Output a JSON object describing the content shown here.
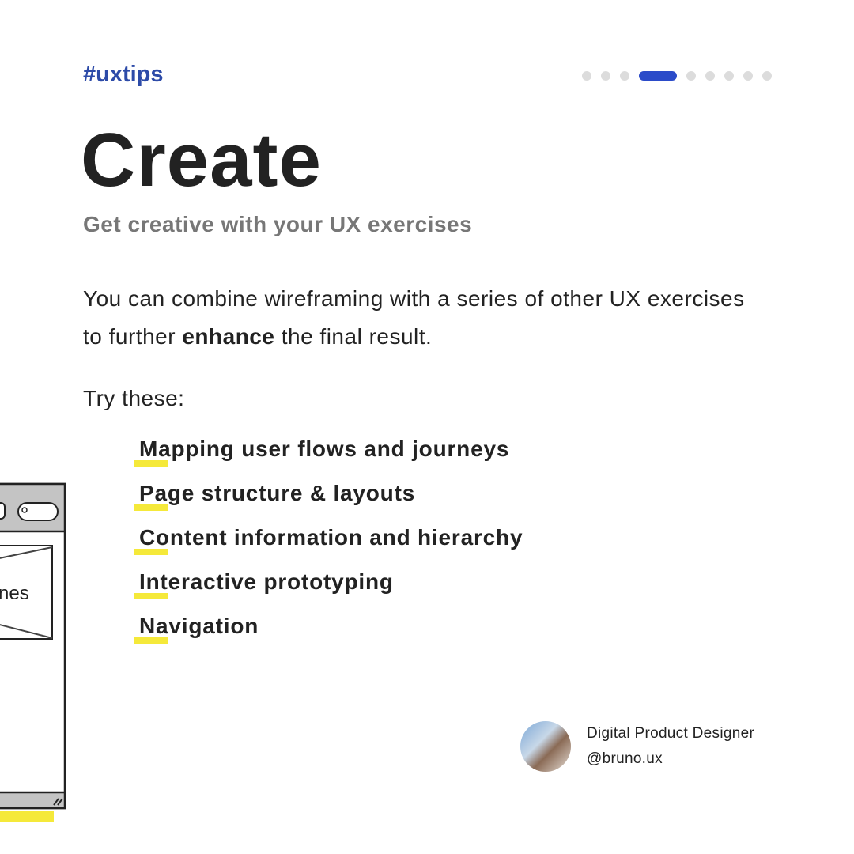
{
  "header": {
    "tag": "#uxtips",
    "pagination": {
      "total": 9,
      "active_index": 3,
      "active_color": "#2b4bc9"
    }
  },
  "title": "Create",
  "subtitle": "Get creative with your UX exercises",
  "body": {
    "line_before": "You can combine wireframing with a series of other UX exercises to further ",
    "bold": "enhance",
    "line_after": " the final result."
  },
  "try_label": "Try these:",
  "list": [
    {
      "label": "Mapping user flows and journeys"
    },
    {
      "label": "Page structure & layouts"
    },
    {
      "label": "Content information and hierarchy"
    },
    {
      "label": "Interactive prototyping"
    },
    {
      "label": "Navigation"
    }
  ],
  "illustration": {
    "text": "nes",
    "icon": "wireframe-browser-sketch"
  },
  "author": {
    "role": "Digital Product Designer",
    "handle": "@bruno.ux"
  },
  "colors": {
    "accent": "#2d4ba8",
    "highlight": "#f5e93a",
    "subtitle": "#777777"
  }
}
